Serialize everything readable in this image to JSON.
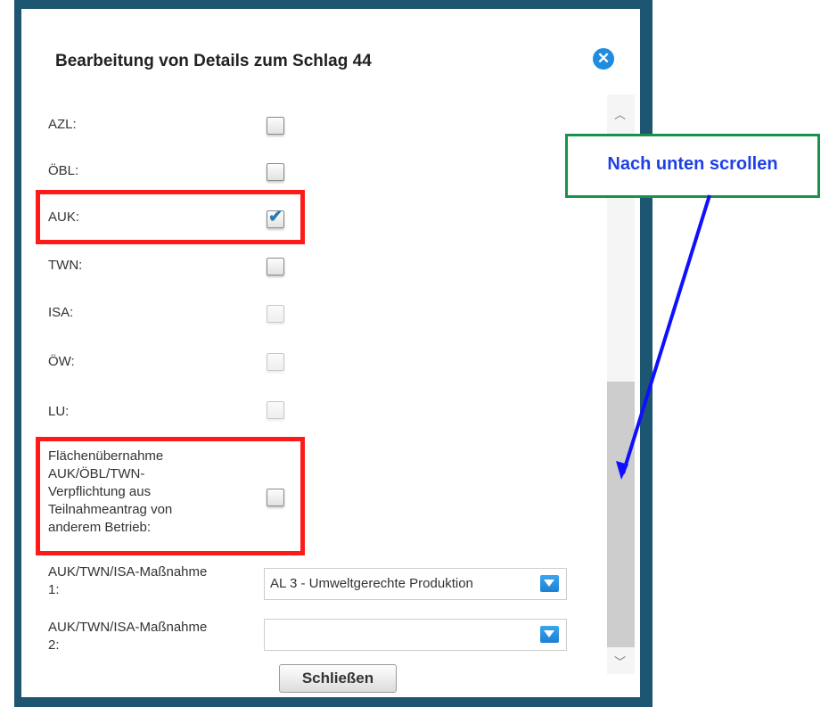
{
  "dialog": {
    "title": "Bearbeitung von Details zum Schlag 44",
    "close_icon": "close-icon"
  },
  "fields": [
    {
      "label": "AZL:",
      "checked": false,
      "enabled": true
    },
    {
      "label": "ÖBL:",
      "checked": false,
      "enabled": true
    },
    {
      "label": "AUK:",
      "checked": true,
      "enabled": true
    },
    {
      "label": "TWN:",
      "checked": false,
      "enabled": true
    },
    {
      "label": "ISA:",
      "checked": false,
      "enabled": false
    },
    {
      "label": "ÖW:",
      "checked": false,
      "enabled": false
    },
    {
      "label": "LU:",
      "checked": false,
      "enabled": false
    }
  ],
  "transfer": {
    "label_lines": [
      "Flächenübernahme",
      "AUK/ÖBL/TWN-",
      "Verpflichtung aus",
      "Teilnahmeantrag von",
      "anderem Betrieb:"
    ],
    "checked": false
  },
  "measures": [
    {
      "label_lines": [
        "AUK/TWN/ISA-Maßnahme",
        "1:"
      ],
      "value": "AL 3 - Umweltgerechte Produktion"
    },
    {
      "label_lines": [
        "AUK/TWN/ISA-Maßnahme",
        "2:"
      ],
      "value": ""
    }
  ],
  "buttons": {
    "close_label": "Schließen"
  },
  "annotation": {
    "callout_text": "Nach unten scrollen",
    "highlight_color": "#ff1a1a",
    "callout_border_color": "#18914a",
    "callout_text_color": "#1f3fe6",
    "arrow_color": "#1010ff"
  },
  "colors": {
    "frame": "#1c5670",
    "accent": "#1e8ce0"
  }
}
